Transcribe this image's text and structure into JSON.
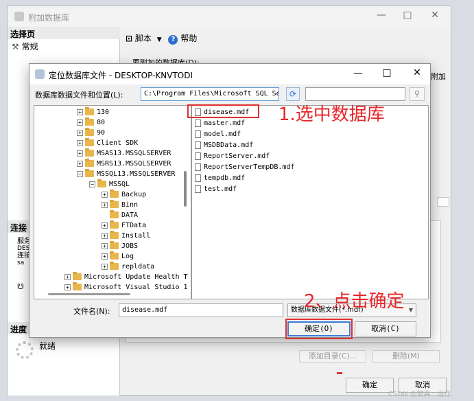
{
  "back_dialog": {
    "title": "附加数据库",
    "select_page_header": "选择页",
    "general_item": "常规",
    "toolbar": {
      "script": "脚本",
      "help": "帮助"
    },
    "db_to_attach_label": "要附加的数据库(D):",
    "right_cut_text": "附加",
    "connection_header": "连接",
    "server_label": "服务",
    "server_value": "DESI",
    "connection_label": "连接",
    "connection_value": "sa",
    "progress_header": "进度",
    "progress_status": "就绪",
    "add_catalog_button": "添加目录(C)...",
    "remove_button": "删除(M)",
    "ok_button": "确定",
    "cancel_button": "取消"
  },
  "front_dialog": {
    "title": "定位数据库文件 - DESKTOP-KNVTODI",
    "path_label": "数据库数据文件和位置(L):",
    "path_value": "C:\\Program Files\\Microsoft SQL Serve",
    "tree": [
      {
        "label": "130"
      },
      {
        "label": "80"
      },
      {
        "label": "90"
      },
      {
        "label": "Client SDK"
      },
      {
        "label": "MSAS13.MSSQLSERVER"
      },
      {
        "label": "MSRS13.MSSQLSERVER"
      },
      {
        "label": "MSSQL13.MSSQLSERVER"
      },
      {
        "label": "MSSQL"
      },
      {
        "label": "Backup"
      },
      {
        "label": "Binn"
      },
      {
        "label": "DATA"
      },
      {
        "label": "FTData"
      },
      {
        "label": "Install"
      },
      {
        "label": "JOBS"
      },
      {
        "label": "Log"
      },
      {
        "label": "repldata"
      },
      {
        "label": "Microsoft Update Health T"
      },
      {
        "label": "Microsoft Visual Studio 1"
      }
    ],
    "files": [
      "disease.mdf",
      "master.mdf",
      "model.mdf",
      "MSDBData.mdf",
      "ReportServer.mdf",
      "ReportServerTempDB.mdf",
      "tempdb.mdf",
      "test.mdf"
    ],
    "filename_label": "文件名(N):",
    "filename_value": "disease.mdf",
    "filetype_value": "数据库数据文件(*.mdf)",
    "ok_button": "确定(O)",
    "cancel_button": "取消(C)"
  },
  "annotations": {
    "step1": "1.选中数据库",
    "step2": "2、点击确定"
  },
  "watermark": "CSDN @放弃 · 治疗",
  "colors": {
    "annotation_red": "#e8262a",
    "folder_yellow": "#e8b64a",
    "accent_blue": "#2c6fd1"
  }
}
